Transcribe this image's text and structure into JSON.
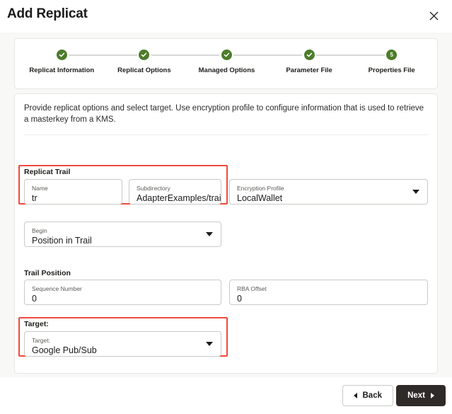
{
  "dialog": {
    "title": "Add Replicat",
    "close_icon": "close-icon"
  },
  "stepper": {
    "steps": [
      {
        "label": "Replicat Information",
        "state": "complete",
        "marker": "check-icon"
      },
      {
        "label": "Replicat Options",
        "state": "complete",
        "marker": "check-icon"
      },
      {
        "label": "Managed Options",
        "state": "complete",
        "marker": "check-icon"
      },
      {
        "label": "Parameter File",
        "state": "complete",
        "marker": "check-icon"
      },
      {
        "label": "Properties File",
        "state": "current",
        "marker": "5"
      }
    ]
  },
  "main": {
    "description": "Provide replicat options and select target. Use encryption profile to configure information that is used to retrieve a masterkey from a KMS.",
    "sections": {
      "replicat_trail": {
        "label": "Replicat Trail",
        "highlighted": true,
        "fields": {
          "name": {
            "label": "Name",
            "value": "tr"
          },
          "subdirectory": {
            "label": "Subdirectory",
            "value": "AdapterExamples/trail/"
          }
        }
      },
      "encryption_profile": {
        "label": "Encryption Profile",
        "value": "LocalWallet",
        "caret_icon": "chevron-down-icon"
      },
      "begin": {
        "label": "Begin",
        "value": "Position in Trail",
        "caret_icon": "chevron-down-icon"
      },
      "trail_position": {
        "label": "Trail Position",
        "fields": {
          "sequence_number": {
            "label": "Sequence Number",
            "value": "0"
          },
          "rba_offset": {
            "label": "RBA Offset",
            "value": "0"
          }
        }
      },
      "target": {
        "label": "Target:",
        "highlighted": true,
        "field": {
          "label": "Target:",
          "value": "Google Pub/Sub",
          "caret_icon": "chevron-down-icon"
        }
      }
    }
  },
  "footer": {
    "back_label": "Back",
    "back_icon": "triangle-left-icon",
    "next_label": "Next",
    "next_icon": "triangle-right-icon"
  },
  "colors": {
    "step_complete": "#4d7c2a",
    "highlight_border": "#ef4b3c",
    "primary_button_bg": "#2e2a28",
    "page_bg": "#f8f8f7"
  }
}
